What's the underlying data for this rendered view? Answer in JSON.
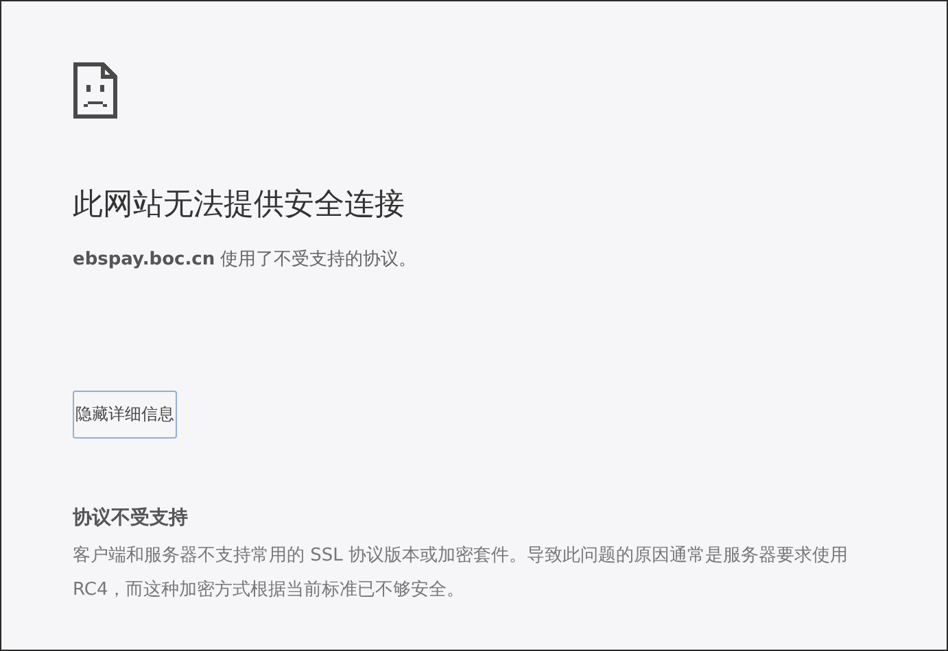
{
  "error": {
    "title": "此网站无法提供安全连接",
    "message": "**ebspay.boc.cn** 使用了不受支持的协议。"
  },
  "details_button": {
    "label": "隐藏详细信息"
  },
  "details": {
    "heading": "协议不受支持",
    "body": "客户端和服务器不支持常用的 SSL 协议版本或加密套件。导致此问题的原因通常是服务器要求使用 RC4，而这种加密方式根据当前标准已不够安全。"
  }
}
